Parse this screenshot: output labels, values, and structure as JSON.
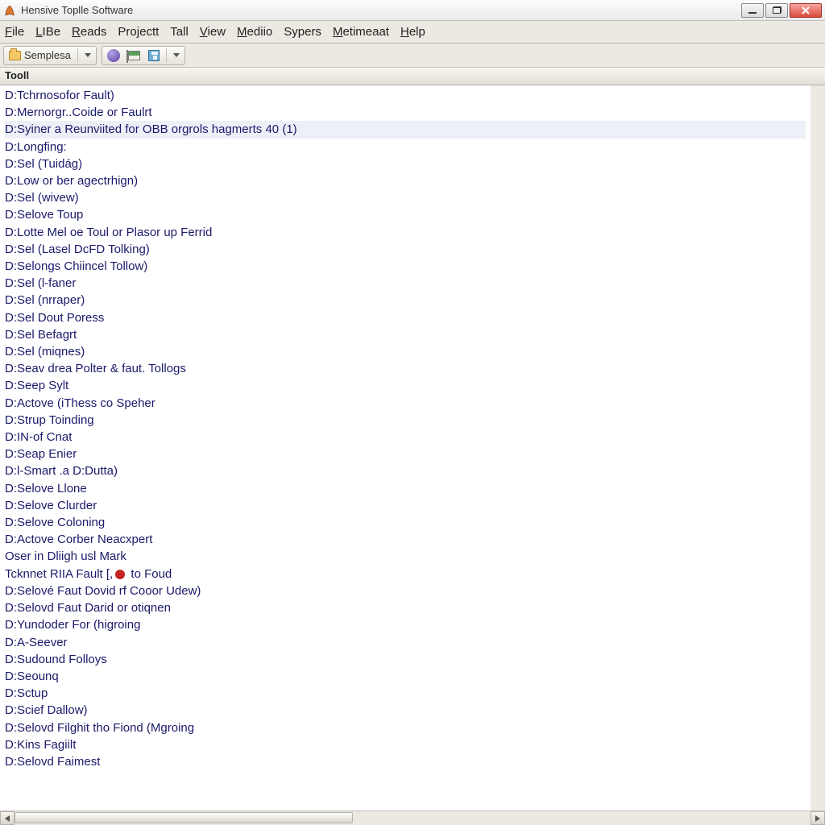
{
  "window": {
    "title": "Hensive Toplle Software"
  },
  "menu": {
    "items": [
      {
        "label": "File",
        "ul_index": 0
      },
      {
        "label": "LIBe",
        "ul_index": 0
      },
      {
        "label": "Reads",
        "ul_index": 0
      },
      {
        "label": "Projectt",
        "ul_index": -1
      },
      {
        "label": "Tall",
        "ul_index": -1
      },
      {
        "label": "View",
        "ul_index": 0
      },
      {
        "label": "Mediio",
        "ul_index": 0
      },
      {
        "label": "Sypers",
        "ul_index": -1
      },
      {
        "label": "Metimeaat",
        "ul_index": 0
      },
      {
        "label": "Help",
        "ul_index": 0
      }
    ]
  },
  "toolbar": {
    "group1_label": "Semplesa"
  },
  "list_header": "Tooll",
  "rows": [
    {
      "text": "D:Tchrnosofor Fault)"
    },
    {
      "text": "D:Mernorgr..Coide or Faulrt"
    },
    {
      "text": "D:Syiner a Reunviited for OBB orgrols hagmerts 40 (1)",
      "selected": true
    },
    {
      "text": "D:Longfing:"
    },
    {
      "text": "D:Sel (Tuidág)"
    },
    {
      "text": "D:Low or ber agectrhign)"
    },
    {
      "text": "D:Sel (wivew)"
    },
    {
      "text": "D:Selove Toup"
    },
    {
      "text": "D:Lotte Mel oe Toul or Plasor up Ferrid"
    },
    {
      "text": "D:Sel (Lasel DcFD Tolking)"
    },
    {
      "text": "D:Selongs Chiincel Tollow)"
    },
    {
      "text": "D:Sel (l-faner"
    },
    {
      "text": "D:Sel (nrraper)"
    },
    {
      "text": "D:Sel Dout Poress"
    },
    {
      "text": "D:Sel Befagrt"
    },
    {
      "text": "D:Sel (miqnes)"
    },
    {
      "text": "D:Seav drea Polter & faut. Tollogs"
    },
    {
      "text": "D:Seep Sylt"
    },
    {
      "text": "D:Actove (iThess co Speher"
    },
    {
      "text": "D:Strup Toinding"
    },
    {
      "text": "D:IN-of Cnat"
    },
    {
      "text": "D:Seap Enier"
    },
    {
      "text": "D:l-Smart .a D:Dutta)"
    },
    {
      "text": "D:Selove Llone"
    },
    {
      "text": "D:Selove Clurder"
    },
    {
      "text": "D:Selove Coloning"
    },
    {
      "text": "D:Actove Corber Neacxpert"
    },
    {
      "text": "Oser in Dliigh usl Mark"
    },
    {
      "text": "Tcknnet RIIA Fault [,",
      "has_dot": true,
      "after_dot": " to Foud"
    },
    {
      "text": "D:Selové Faut Dovid rf Cooor Udew)"
    },
    {
      "text": "D:Selovd Faut Darid or otiqnen"
    },
    {
      "text": "D:Yundoder For (higroing"
    },
    {
      "text": "D:A-Seever"
    },
    {
      "text": "D:Sudound Folloys"
    },
    {
      "text": "D:Seounq"
    },
    {
      "text": "D:Sctup"
    },
    {
      "text": "D:Scief Dallow)"
    },
    {
      "text": "D:Selovd Filghit tho Fiond (Mgroing"
    },
    {
      "text": "D:Kins Fagiilt"
    },
    {
      "text": "D:Selovd Faimest"
    }
  ]
}
